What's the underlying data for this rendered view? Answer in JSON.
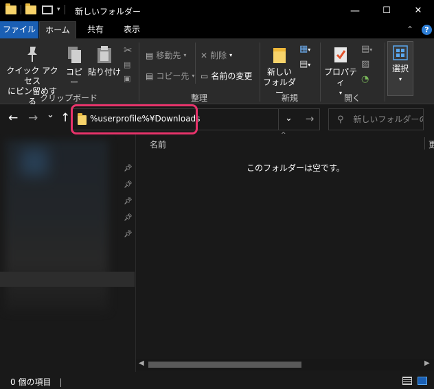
{
  "window": {
    "title": "新しいフォルダー",
    "minimize": "—",
    "maximize": "☐",
    "close": "✕"
  },
  "ribbon_tabs": {
    "file": "ファイル",
    "home": "ホーム",
    "share": "共有",
    "view": "表示",
    "collapse": "⌃",
    "help": "?"
  },
  "ribbon": {
    "clipboard": {
      "pin_label_1": "クイック アクセス",
      "pin_label_2": "にピン留めする",
      "copy": "コピー",
      "paste": "貼り付け",
      "group": "クリップボード"
    },
    "organize": {
      "move_to": "移動先",
      "copy_to": "コピー先",
      "delete": "削除",
      "rename": "名前の変更",
      "group": "整理"
    },
    "new": {
      "new_folder_1": "新しい",
      "new_folder_2": "フォルダー",
      "group": "新規"
    },
    "open": {
      "properties": "プロパティ",
      "group": "開く"
    },
    "select": {
      "select": "選択"
    }
  },
  "navigation": {
    "back": "←",
    "forward": "→",
    "recent": "⌄",
    "up": "↑",
    "address": "%userprofile%¥Downloads",
    "dropdown": "⌄",
    "go": "→",
    "search_placeholder": "新しいフォルダーの..."
  },
  "content": {
    "column_name": "名前",
    "column_next": "更",
    "empty_message": "このフォルダーは空です。"
  },
  "status": {
    "item_count": "0 個の項目"
  },
  "colors": {
    "accent_file_tab": "#1a5fb4",
    "highlight": "#e8336b",
    "folder": "#f7d36a"
  }
}
